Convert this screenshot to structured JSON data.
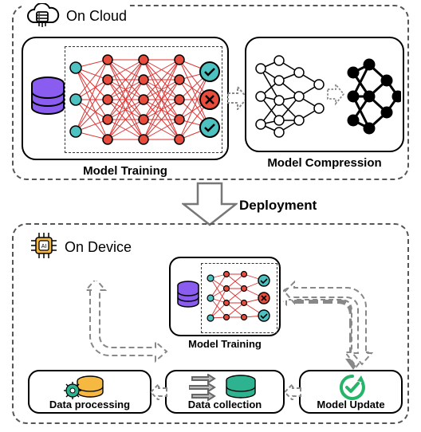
{
  "cloud": {
    "title": "On Cloud",
    "train_caption": "Model Training",
    "compress_caption": "Model Compression"
  },
  "deployment_label": "Deployment",
  "device": {
    "title": "On Device",
    "mtrain_caption": "Model Training",
    "dataproc_caption": "Data processing",
    "datacoll_caption": "Data collection",
    "mupdate_caption": "Model Update"
  }
}
